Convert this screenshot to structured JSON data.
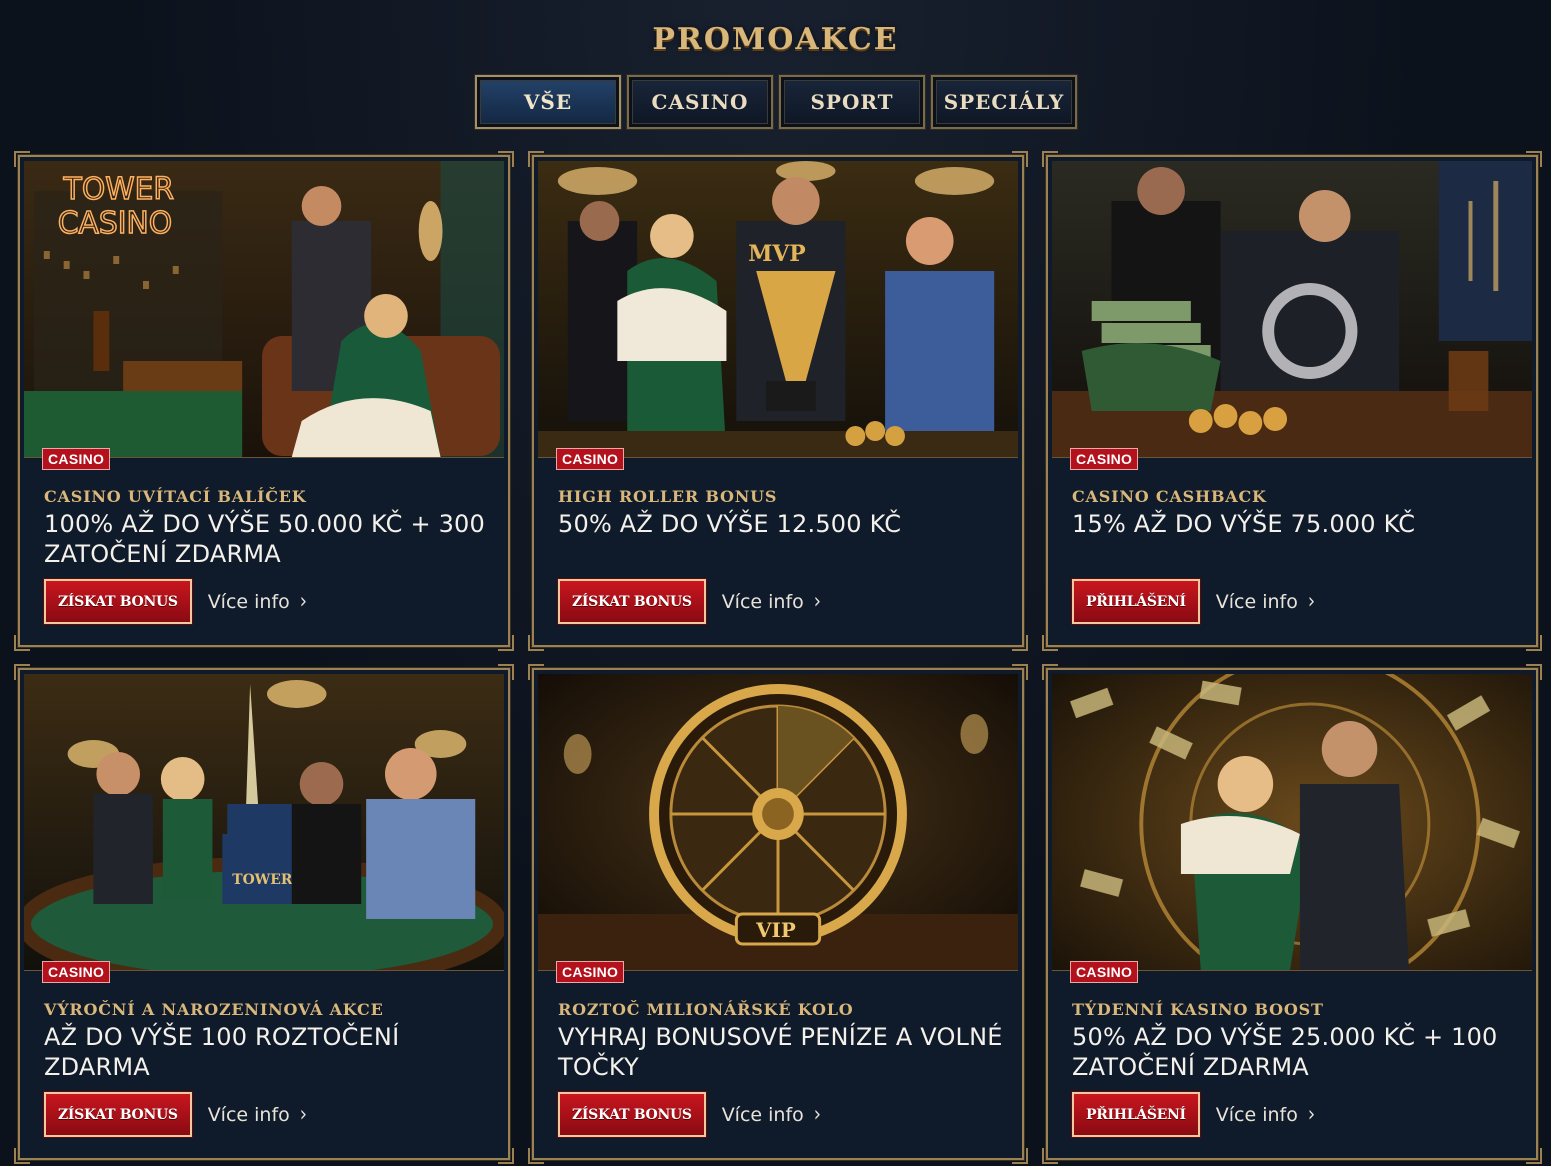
{
  "page": {
    "title": "PROMOAKCE"
  },
  "tabs": [
    {
      "label": "VŠE",
      "active": true
    },
    {
      "label": "CASINO",
      "active": false
    },
    {
      "label": "SPORT",
      "active": false
    },
    {
      "label": "SPECIÁLY",
      "active": false
    }
  ],
  "colors": {
    "background": "#0c121c",
    "gold": "#d9b679",
    "card_bg": "#0f1a2a",
    "badge_red": "#b3121c",
    "button_red": "#c8161f"
  },
  "cards": [
    {
      "badge": "CASINO",
      "subtitle": "CASINO UVÍTACÍ BALÍČEK",
      "headline": "100% AŽ DO VÝŠE 50.000 KČ + 300 ZATOČENÍ ZDARMA",
      "cta": "ZÍSKAT BONUS",
      "more": "Více info",
      "image": "tower-casino-celebration-image"
    },
    {
      "badge": "CASINO",
      "subtitle": "HIGH ROLLER BONUS",
      "headline": "50% AŽ DO VÝŠE 12.500 KČ",
      "cta": "ZÍSKAT BONUS",
      "more": "Více info",
      "image": "mvp-trophy-image"
    },
    {
      "badge": "CASINO",
      "subtitle": "CASINO CASHBACK",
      "headline": "15% AŽ DO VÝŠE 75.000 KČ",
      "cta": "PŘIHLÁŠENÍ",
      "more": "Více info",
      "image": "cashback-money-image"
    },
    {
      "badge": "CASINO",
      "subtitle": "VÝROČNÍ A NAROZENINOVÁ AKCE",
      "headline": "AŽ DO VÝŠE 100 ROZTOČENÍ ZDARMA",
      "cta": "ZÍSKAT BONUS",
      "more": "Více info",
      "image": "birthday-party-image"
    },
    {
      "badge": "CASINO",
      "subtitle": "ROZTOČ MILIONÁŘSKÉ KOLO",
      "headline": "VYHRAJ BONUSOVÉ PENÍZE A VOLNÉ TOČKY",
      "cta": "ZÍSKAT BONUS",
      "more": "Více info",
      "image": "vip-wheel-image",
      "image_text": "VIP"
    },
    {
      "badge": "CASINO",
      "subtitle": "TÝDENNÍ KASINO BOOST",
      "headline": "50% AŽ DO VÝŠE 25.000 KČ + 100 ZATOČENÍ ZDARMA",
      "cta": "PŘIHLÁŠENÍ",
      "more": "Více info",
      "image": "money-rain-image"
    }
  ],
  "image_texts": {
    "tower_sign_line1": "TOWER",
    "tower_sign_line2": "CASINO",
    "mvp": "MVP",
    "cake": "TOWER"
  }
}
